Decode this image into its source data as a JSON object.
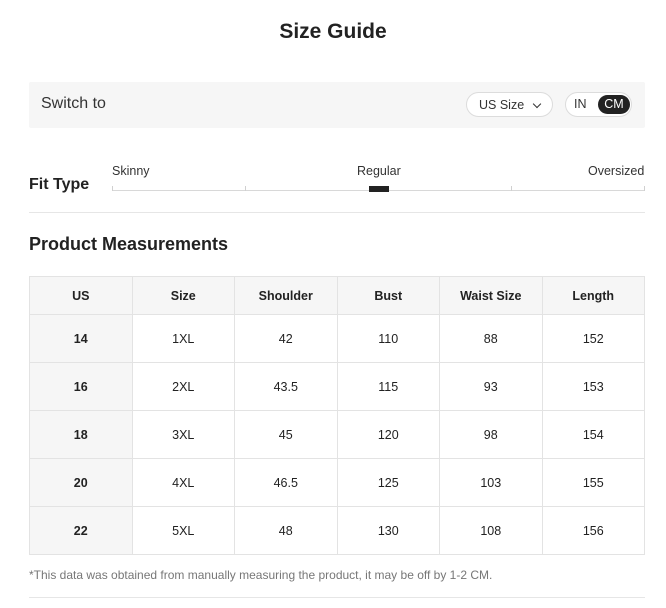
{
  "title": "Size Guide",
  "switch": {
    "label": "Switch to",
    "size_select": "US Size",
    "unit_in": "IN",
    "unit_cm": "CM",
    "active_unit": "CM"
  },
  "fit": {
    "label": "Fit Type",
    "options": [
      "Skinny",
      "Regular",
      "Oversized"
    ],
    "selected": "Regular"
  },
  "measurements": {
    "title": "Product Measurements",
    "headers": [
      "US",
      "Size",
      "Shoulder",
      "Bust",
      "Waist Size",
      "Length"
    ],
    "rows": [
      [
        "14",
        "1XL",
        "42",
        "110",
        "88",
        "152"
      ],
      [
        "16",
        "2XL",
        "43.5",
        "115",
        "93",
        "153"
      ],
      [
        "18",
        "3XL",
        "45",
        "120",
        "98",
        "154"
      ],
      [
        "20",
        "4XL",
        "46.5",
        "125",
        "103",
        "155"
      ],
      [
        "22",
        "5XL",
        "48",
        "130",
        "108",
        "156"
      ]
    ]
  },
  "footnote": "*This data was obtained from manually measuring the product, it may be off by 1-2 CM."
}
